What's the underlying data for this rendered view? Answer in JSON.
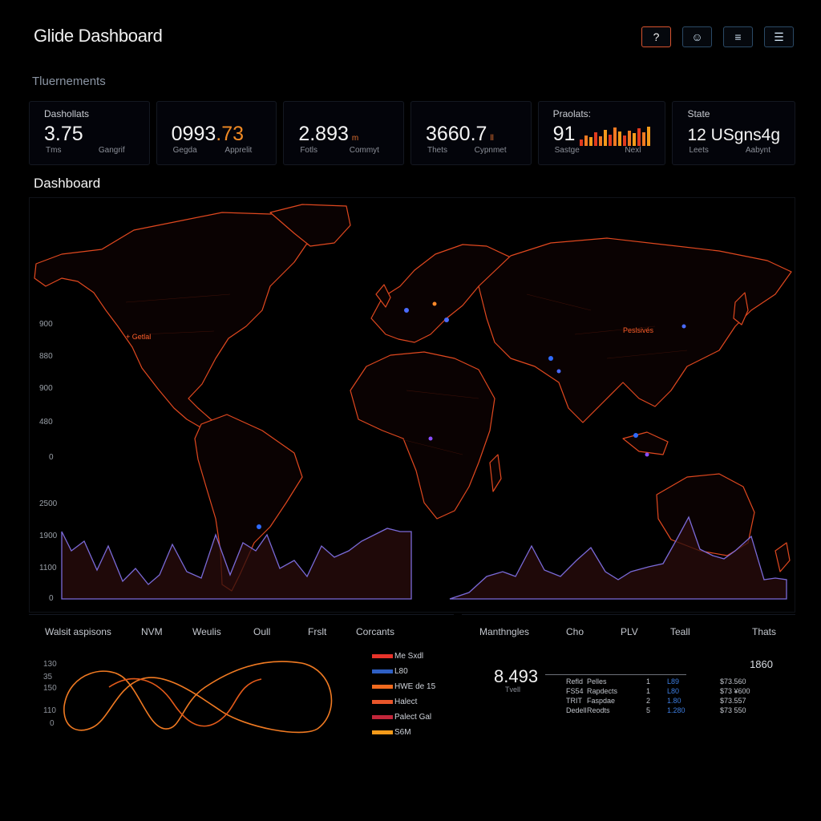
{
  "app": {
    "title": "Glide Dashboard"
  },
  "header": {
    "buttons": [
      {
        "icon": "help-icon",
        "glyph": "?"
      },
      {
        "icon": "user-icon",
        "glyph": "☺"
      },
      {
        "icon": "list-icon",
        "glyph": "≡"
      },
      {
        "icon": "menu-icon",
        "glyph": "☰"
      }
    ]
  },
  "section": {
    "label": "Tluernements"
  },
  "stats": [
    {
      "label": "Dashollats",
      "value": "3.75",
      "unit": "",
      "foot_left": "Tms",
      "foot_right": "Gangrif"
    },
    {
      "label": "",
      "value_main": "0993",
      "value_accent": ".73",
      "unit": "",
      "foot_left": "Gegda",
      "foot_right": "Apprelit"
    },
    {
      "label": "",
      "value": "2.893",
      "unit": "m",
      "foot_left": "Fotls",
      "foot_right": "Commyt"
    },
    {
      "label": "",
      "value": "3660.7",
      "unit": "ll",
      "foot_left": "Thets",
      "foot_right": "Cypnmet"
    },
    {
      "label": "Praolats:",
      "value": "91",
      "unit": "",
      "foot_left": "Sastge",
      "foot_right": "Nexl"
    },
    {
      "label": "State",
      "value": "12 USgns4g",
      "unit": "",
      "foot_left": "Leets",
      "foot_right": "Aabynt"
    }
  ],
  "spark_levels": [
    0.35,
    0.55,
    0.45,
    0.7,
    0.5,
    0.85,
    0.6,
    0.95,
    0.75,
    0.55,
    0.8,
    0.65,
    0.9,
    0.7,
    1.0
  ],
  "map": {
    "title": "Dashboard",
    "y_ticks": [
      "900",
      "880",
      "900",
      "480",
      "0",
      "2500",
      "1900",
      "1100",
      "0"
    ],
    "labels": [
      {
        "text": "+ Getlal"
      },
      {
        "text": "Peslsivés"
      }
    ]
  },
  "bottom_left": {
    "headers": [
      "Walsit aspisons",
      "NVM",
      "Weulis",
      "Oull",
      "Frslt",
      "Corcants"
    ],
    "y_ticks": [
      "130",
      "35",
      "150",
      "110",
      "0"
    ],
    "legend": [
      {
        "label": "Me Sxdl",
        "color": "#e8332a"
      },
      {
        "label": "L80",
        "color": "#2e5fc4"
      },
      {
        "label": "HWE de 15",
        "color": "#f06a1e"
      },
      {
        "label": "Halect",
        "color": "#e8552a"
      },
      {
        "label": "Palect Gal",
        "color": "#c2263a"
      },
      {
        "label": "S6M",
        "color": "#f39a1a"
      }
    ]
  },
  "bottom_right": {
    "headers": [
      "Manthngles",
      "Cho",
      "PLV",
      "Teall",
      "Thats"
    ],
    "big_value": "8.493",
    "big_sub": "Tvell",
    "total": "1860",
    "rows": [
      [
        "Refld",
        "Pelles",
        "1",
        "L89",
        "$73.560"
      ],
      [
        "FS54",
        "Rapdects",
        "1",
        "L80",
        "$73 ¥600"
      ],
      [
        "TRIT",
        "Faspdae",
        "2",
        "1.80",
        "$73.557"
      ],
      [
        "Dedell",
        "Reodts",
        "5",
        "1.280",
        "$73 550"
      ]
    ]
  }
}
